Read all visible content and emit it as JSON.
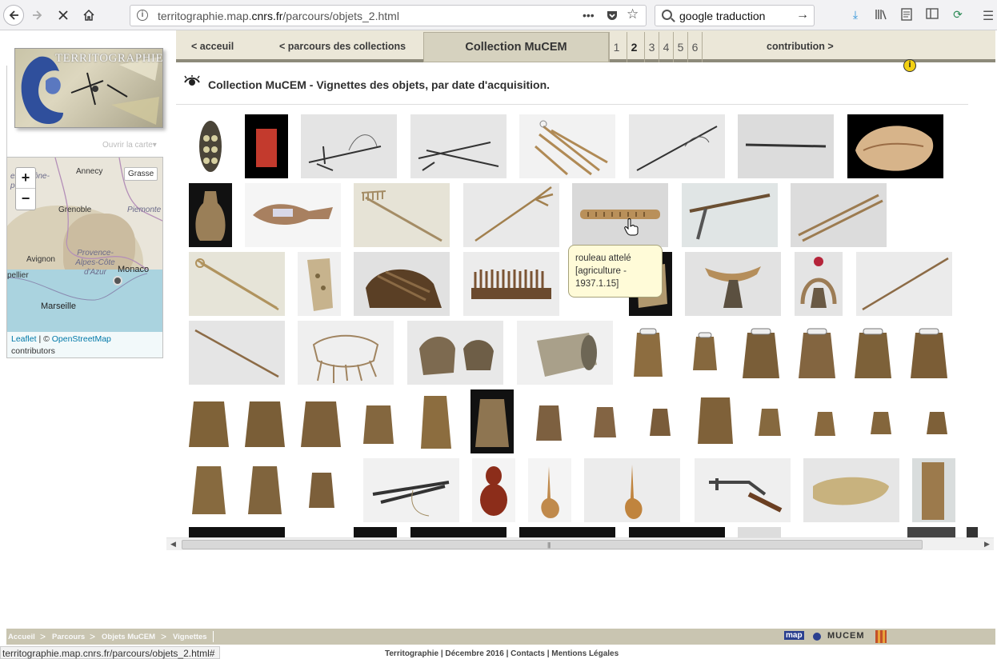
{
  "browser": {
    "url_prefix": "territographie.map.",
    "url_domain": "cnrs.fr",
    "url_path": "/parcours/objets_2.html",
    "search_value": "google traduction"
  },
  "logo": {
    "title": "TERRITOGRAPHIE"
  },
  "sidebar": {
    "open_map_label": "Ouvrir la carte"
  },
  "map": {
    "basemap_button": "Grasse",
    "zoom_in": "+",
    "zoom_out": "−",
    "labels": {
      "annecy": "Annecy",
      "grenoble": "Grenoble",
      "piemonte": "Piemonte",
      "avignon": "Avignon",
      "provence": "Provence-Alpes-Côte d'Azur",
      "monaco": "Monaco",
      "marseille": "Marseille",
      "montpellier": "pellier",
      "rhone": "ergne-ône-pes"
    },
    "attribution_leaflet": "Leaflet",
    "attribution_sep": " | © ",
    "attribution_osm": "OpenStreetMap",
    "attribution_contrib": "contributors"
  },
  "topnav": {
    "home": "< acceuil",
    "collections": "< parcours des collections",
    "collection_title": "Collection MuCEM",
    "pages": [
      "1",
      "2",
      "3",
      "4",
      "5",
      "6"
    ],
    "active_page": "2",
    "contribution": "contribution >"
  },
  "main": {
    "title": "Collection MuCEM - Vignettes des objets, par date d'acquisition."
  },
  "tooltip": {
    "line1": "rouleau attelé",
    "line2": "[agriculture -",
    "line3": "1937.1.15]"
  },
  "footer": {
    "breadcrumbs": [
      "Accueil",
      "Parcours",
      "Objets MuCEM",
      "Vignettes"
    ],
    "links": "Territographie | Décembre 2016 | Contacts | Mentions Légales",
    "partner_logos": [
      "map",
      "MUCEM"
    ]
  },
  "status_bar": "territographie.map.cnrs.fr/parcours/objets_2.html#",
  "thumbnails": [
    {
      "name": "thumb-bag"
    },
    {
      "name": "thumb-red-panel"
    },
    {
      "name": "thumb-snare"
    },
    {
      "name": "thumb-snare-2"
    },
    {
      "name": "thumb-sticks"
    },
    {
      "name": "thumb-rod"
    },
    {
      "name": "thumb-stick"
    },
    {
      "name": "thumb-shell"
    },
    {
      "name": "thumb-flask"
    },
    {
      "name": "thumb-lure"
    },
    {
      "name": "thumb-rake"
    },
    {
      "name": "thumb-fork"
    },
    {
      "name": "thumb-roller"
    },
    {
      "name": "thumb-pick"
    },
    {
      "name": "thumb-poles"
    },
    {
      "name": "thumb-hook"
    },
    {
      "name": "thumb-plate"
    },
    {
      "name": "thumb-harness"
    },
    {
      "name": "thumb-comb"
    },
    {
      "name": "thumb-block"
    },
    {
      "name": "thumb-bell-yoke"
    },
    {
      "name": "thumb-red-yoke"
    },
    {
      "name": "thumb-staff"
    },
    {
      "name": "thumb-staff-2"
    },
    {
      "name": "thumb-net"
    },
    {
      "name": "thumb-bells-pair"
    },
    {
      "name": "thumb-bell-silver"
    },
    {
      "name": "thumb-cowbell-1"
    },
    {
      "name": "thumb-cowbell-2"
    },
    {
      "name": "thumb-cowbell-3"
    },
    {
      "name": "thumb-cowbell-4"
    },
    {
      "name": "thumb-cowbell-5"
    },
    {
      "name": "thumb-cowbell-6"
    }
  ]
}
